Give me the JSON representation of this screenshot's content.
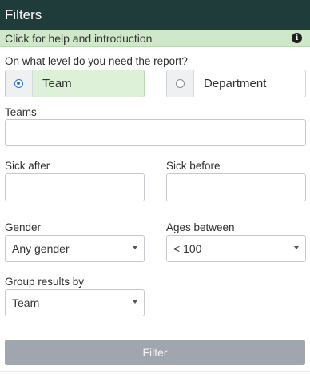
{
  "header": {
    "title": "Filters"
  },
  "help": {
    "text": "Click for help and introduction",
    "icon": "info-icon"
  },
  "level": {
    "question": "On what level do you need the report?",
    "options": [
      {
        "label": "Team",
        "selected": true
      },
      {
        "label": "Department",
        "selected": false
      }
    ]
  },
  "teams": {
    "label": "Teams",
    "value": "",
    "placeholder": ""
  },
  "sick_after": {
    "label": "Sick after",
    "value": "",
    "icon": "calendar-icon"
  },
  "sick_before": {
    "label": "Sick before",
    "value": "",
    "icon": "calendar-icon"
  },
  "gender": {
    "label": "Gender",
    "value": "Any gender"
  },
  "ages": {
    "label": "Ages between",
    "value": "< 100"
  },
  "group": {
    "label": "Group results by",
    "value": "Team"
  },
  "actions": {
    "filter_label": "Filter"
  },
  "colors": {
    "header_bg": "#1f3c3a",
    "help_bg": "#cfe8c9",
    "selected_bg": "#ddf0d8",
    "radio_accent": "#2a73e6",
    "button_bg": "#9fa6ae"
  }
}
